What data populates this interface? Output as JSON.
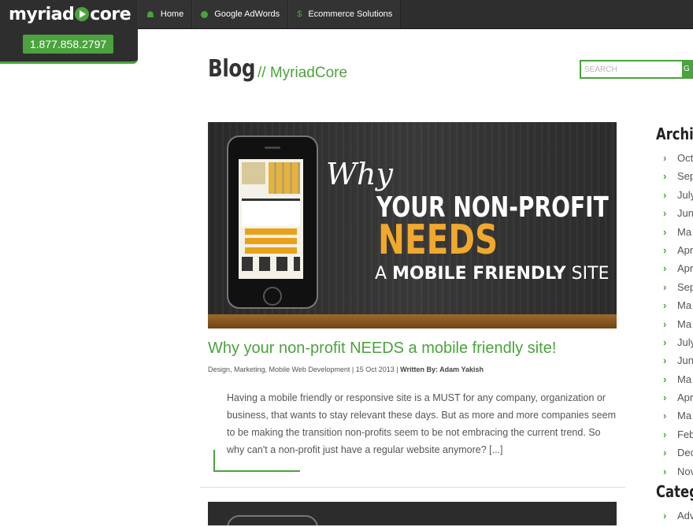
{
  "header": {
    "logo_text_left": "myriad",
    "logo_text_right": "core",
    "phone": "1.877.858.2797"
  },
  "nav": {
    "items": [
      {
        "label": "Home",
        "icon": "home-icon"
      },
      {
        "label": "Google AdWords",
        "icon": "circle-icon"
      },
      {
        "label": "Ecommerce Solutions",
        "icon": "dollar-icon"
      }
    ]
  },
  "page": {
    "title": "Blog",
    "subtitle": "// MyriadCore"
  },
  "search": {
    "placeholder": "SEARCH",
    "button_label": "G"
  },
  "post": {
    "hero": {
      "line_why": "Why",
      "line1": "YOUR NON-PROFIT",
      "line2": "NEEDS",
      "line3_prefix": "A ",
      "line3_bold": "MOBILE FRIENDLY",
      "line3_suffix": " SITE"
    },
    "title": "Why your non-profit NEEDS a mobile friendly site!",
    "meta_categories": "Design, Marketing, Mobile Web Development",
    "meta_date": "15 Oct 2013",
    "meta_author": "Written By: Adam Yakish",
    "excerpt": "Having a mobile friendly or responsive site is a MUST for any company, organization or business, that wants to stay relevant these days. But as more and more companies seem to be making the transition non-profits seem to be not embracing the current trend. So why can't a non-profit just have a regular website anymore? [...]"
  },
  "sidebar": {
    "archives_title": "Archiv",
    "archives": [
      "Oct",
      "Sep",
      "July",
      "Jun",
      "Ma",
      "Apr",
      "Apr",
      "Sep",
      "Ma",
      "Ma",
      "July",
      "Jun",
      "Ma",
      "Apr",
      "Ma",
      "Feb",
      "Dec",
      "Nov"
    ],
    "categories_title": "Catego",
    "categories": [
      "Adv"
    ]
  },
  "colors": {
    "accent": "#4aa33c",
    "nav_bg": "#2e2e2e",
    "hero_orange": "#f0a82e"
  }
}
